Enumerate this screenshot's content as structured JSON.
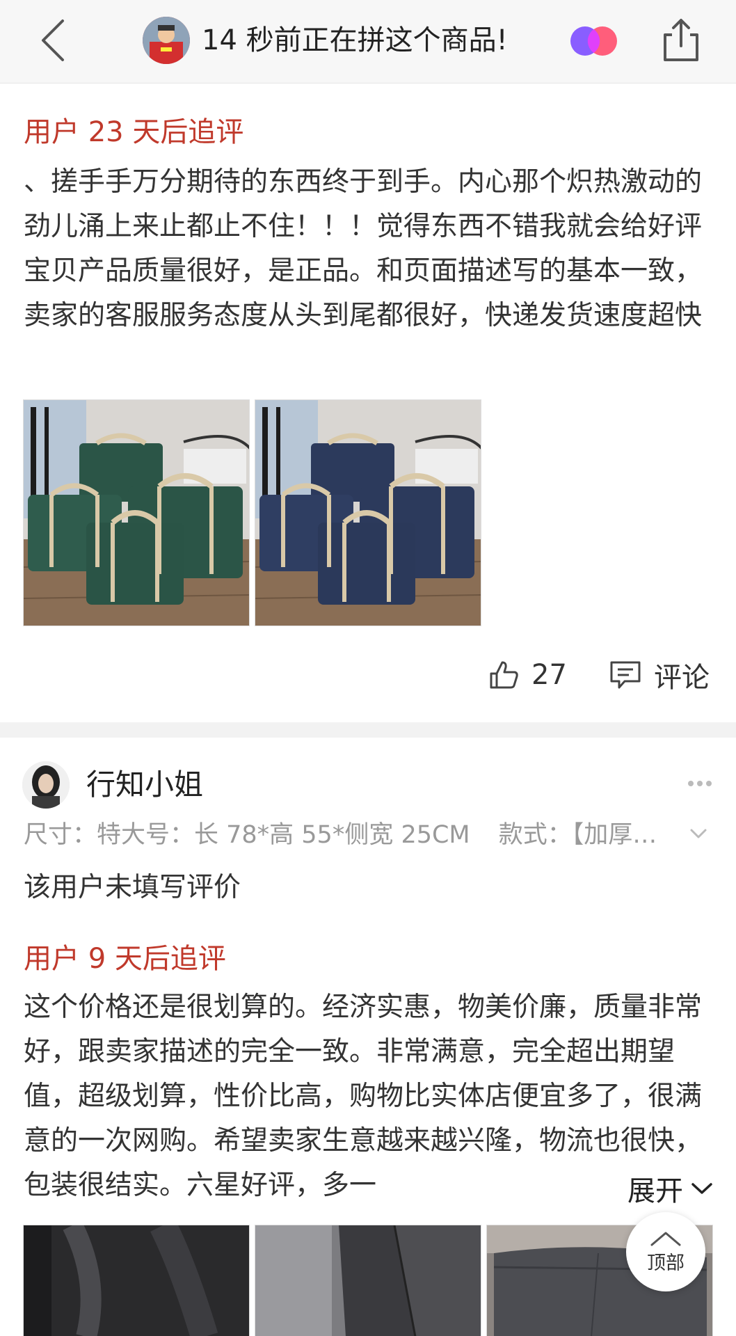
{
  "header": {
    "activity_text": "14 秒前正在拼这个商品!",
    "icons": [
      "back-chevron-icon",
      "user-avatar",
      "brand-circles-icon",
      "share-icon"
    ]
  },
  "review1": {
    "followup_label": "用户 23 天后追评",
    "text": "、搓手手万分期待的东西终于到手。内心那个炽热激动的劲儿涌上来止都止不住！！！觉得东西不错我就会给好评宝贝产品质量很好，是正品。和页面描述写的基本一致，卖家的客服服务态度从头到尾都很好，快递发货速度超快",
    "photos": [
      "green-storage-bags-photo",
      "navy-storage-bags-photo"
    ],
    "like_count": "27",
    "comment_label": "评论"
  },
  "review2": {
    "user_name": "行知小姐",
    "spec_size": "尺寸：特大号：长 78*高 55*侧宽 25CM",
    "spec_style": "款式：【加厚…",
    "no_review_text": "该用户未填写评价",
    "followup_label": "用户 9 天后追评",
    "text": "这个价格还是很划算的。经济实惠，物美价廉，质量非常好，跟卖家描述的完全一致。非常满意，完全超出期望值，超级划算，性价比高，购物比实体店便宜多了，很满意的一次网购。希望卖家生意越来越兴隆，物流也很快，包装很结实。六星好评，多一",
    "expand_label": "展开",
    "photos": [
      "gray-bag-photo-1",
      "gray-bag-photo-2",
      "gray-bag-photo-3"
    ]
  },
  "back_to_top_label": "顶部",
  "colors": {
    "accent_red": "#c0392b",
    "header_bg": "#f7f7f7",
    "muted_text": "#999999",
    "body_text": "#333333"
  }
}
